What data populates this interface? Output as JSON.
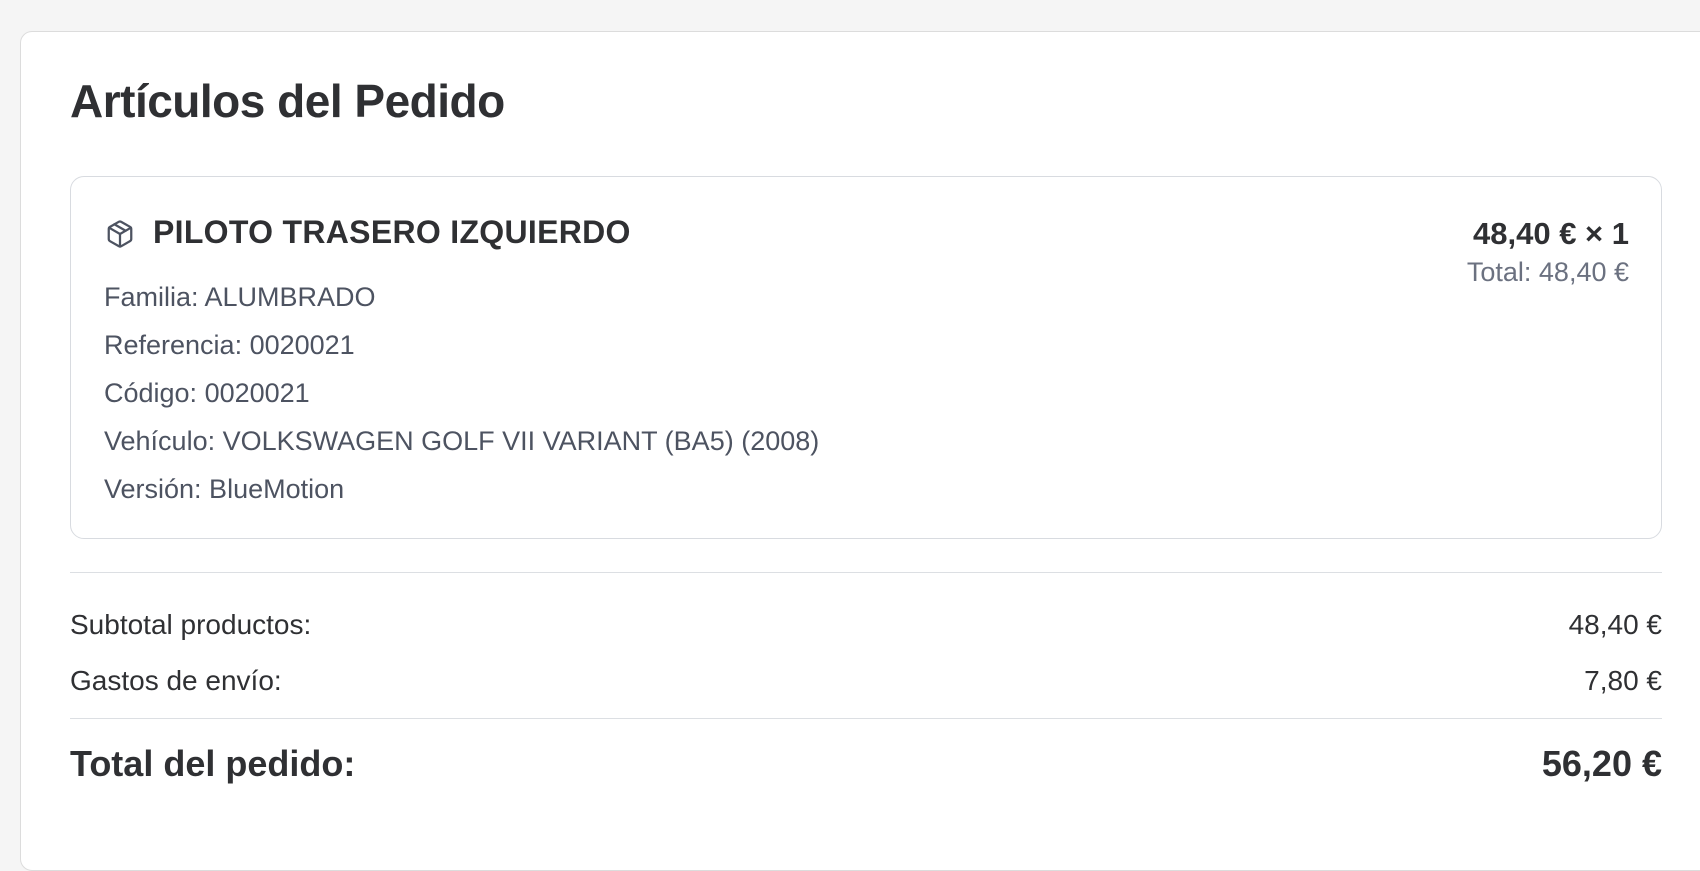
{
  "section": {
    "title": "Artículos del Pedido"
  },
  "items": [
    {
      "icon": "package-icon",
      "name": "PILOTO TRASERO IZQUIERDO",
      "details": [
        "Familia: ALUMBRADO",
        "Referencia: 0020021",
        "Código: 0020021",
        "Vehículo: VOLKSWAGEN GOLF VII VARIANT (BA5) (2008)",
        "Versión: BlueMotion"
      ],
      "unit_price_qty": "48,40 € × 1",
      "line_total": "Total: 48,40 €"
    }
  ],
  "summary": {
    "subtotal_label": "Subtotal productos:",
    "subtotal_value": "48,40 €",
    "shipping_label": "Gastos de envío:",
    "shipping_value": "7,80 €",
    "total_label": "Total del pedido:",
    "total_value": "56,20 €"
  },
  "colors": {
    "text_primary": "#2f3033",
    "text_secondary": "#4d5361",
    "text_muted": "#6b7180",
    "border": "#d8dbe0",
    "background": "#f5f5f5"
  }
}
